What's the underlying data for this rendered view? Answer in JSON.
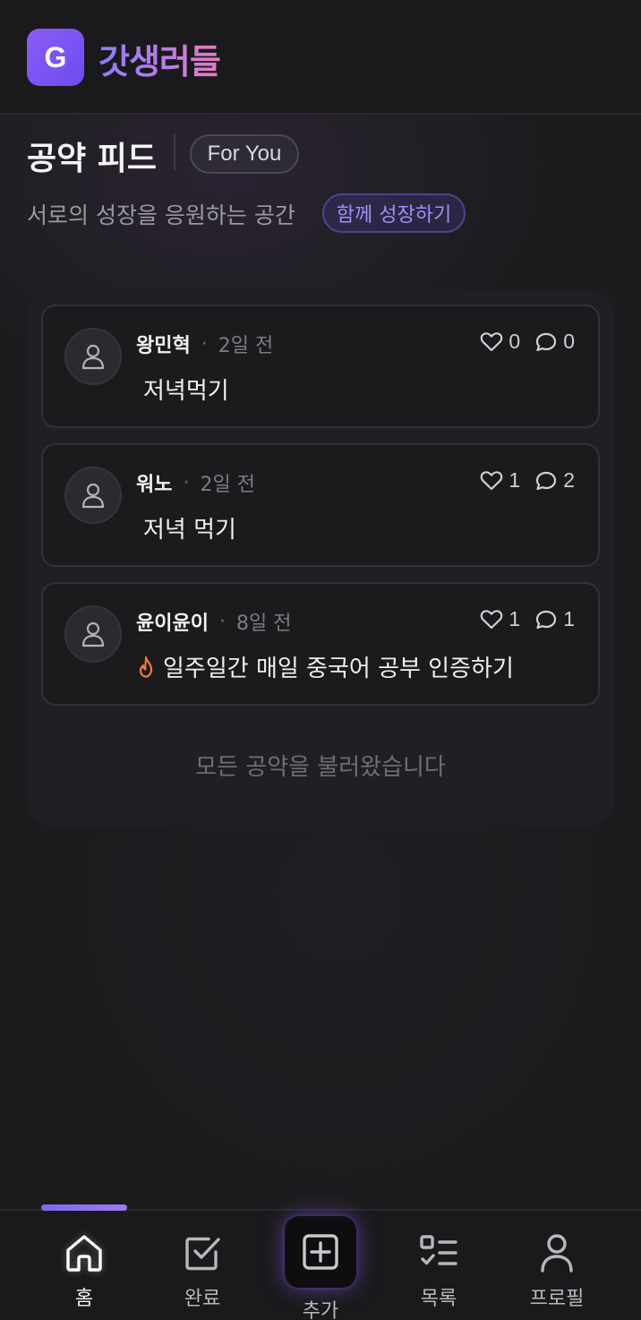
{
  "header": {
    "logo_letter": "G",
    "app_name": "갓생러들"
  },
  "feed": {
    "title": "공약 피드",
    "filter_chip": "For You",
    "subtitle": "서로의 성장을 응원하는 공간",
    "tag_chip": "함께 성장하기",
    "end_message": "모든 공약을 불러왔습니다",
    "separator": "·",
    "posts": [
      {
        "author": "왕민혁",
        "time": "2일 전",
        "text": "저녁먹기",
        "likes": "0",
        "comments": "0",
        "icon": ""
      },
      {
        "author": "워노",
        "time": "2일 전",
        "text": "저녁 먹기",
        "likes": "1",
        "comments": "2",
        "icon": ""
      },
      {
        "author": "윤이윤이",
        "time": "8일 전",
        "text": "일주일간 매일 중국어 공부 인증하기",
        "likes": "1",
        "comments": "1",
        "icon": "fire-icon"
      }
    ]
  },
  "bottom_nav": {
    "items": [
      {
        "label": "홈",
        "icon": "home-icon",
        "active": true
      },
      {
        "label": "완료",
        "icon": "check-square-icon",
        "active": false
      },
      {
        "label": "추가",
        "icon": "plus-square-icon",
        "active": false
      },
      {
        "label": "목록",
        "icon": "list-icon",
        "active": false
      },
      {
        "label": "프로필",
        "icon": "user-icon",
        "active": false
      }
    ]
  },
  "colors": {
    "accent": "#8b5cf6",
    "background": "#1c1c1e",
    "fire": "#f07a3a"
  }
}
